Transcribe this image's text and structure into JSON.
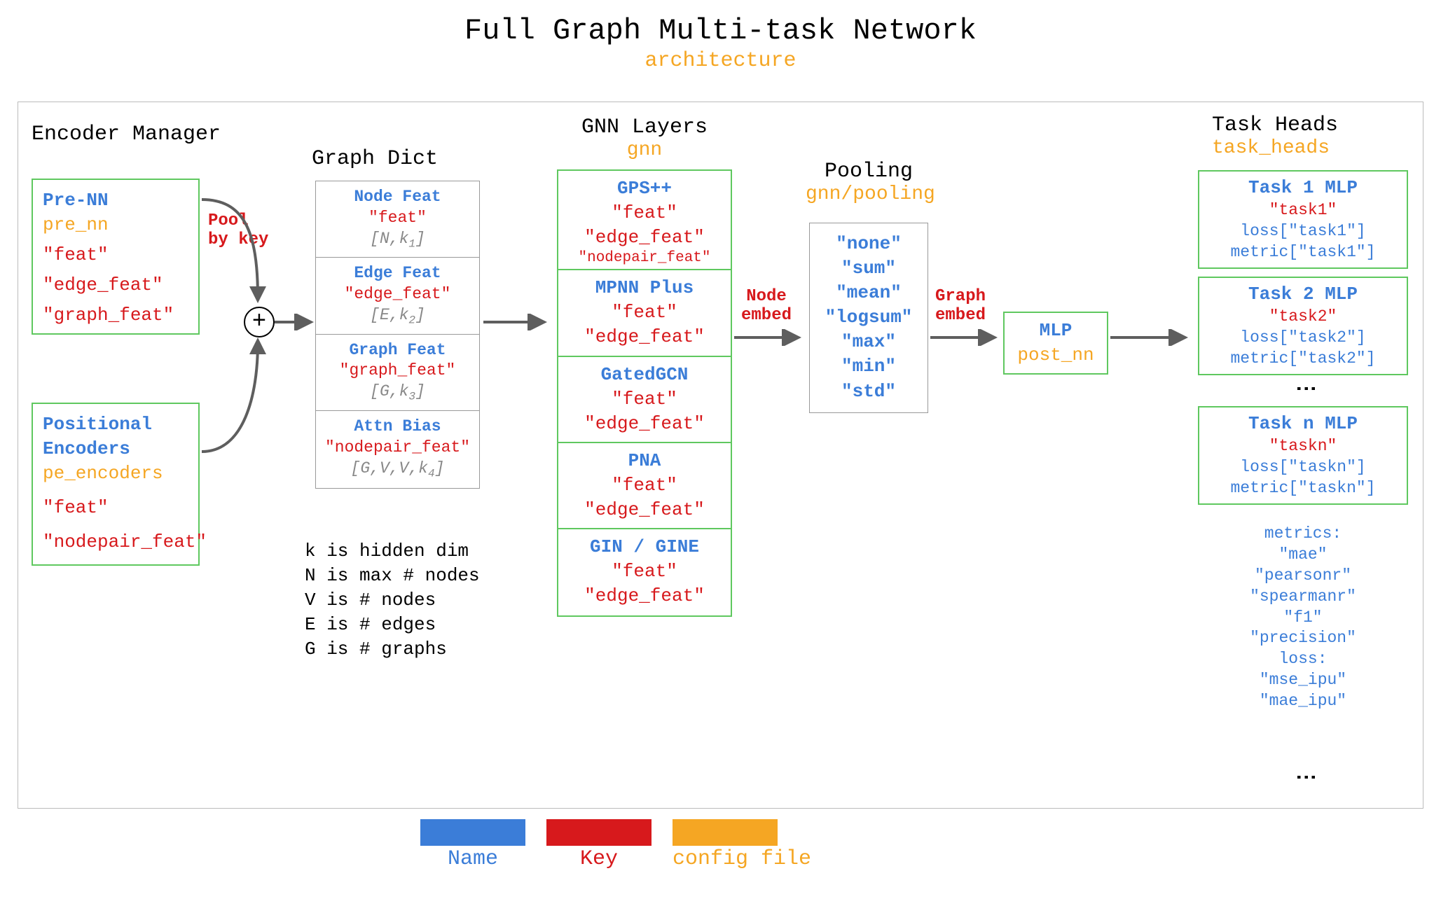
{
  "title": "Full Graph Multi-task Network",
  "subtitle": "architecture",
  "encoder_manager": {
    "title": "Encoder Manager",
    "pre_nn": {
      "name": "Pre-NN",
      "config": "pre_nn",
      "keys": [
        "\"feat\"",
        "\"edge_feat\"",
        "\"graph_feat\""
      ]
    },
    "positional": {
      "name1": "Positional",
      "name2": "Encoders",
      "config": "pe_encoders",
      "keys": [
        "\"feat\"",
        "\"nodepair_feat\""
      ]
    }
  },
  "pool_label": {
    "l1": "Pool",
    "l2": "by key"
  },
  "plus_symbol": "+",
  "graph_dict": {
    "title": "Graph Dict",
    "rows": [
      {
        "name": "Node Feat",
        "key": "\"feat\"",
        "shape_a": "N",
        "shape_b": "k",
        "sub": "1"
      },
      {
        "name": "Edge Feat",
        "key": "\"edge_feat\"",
        "shape_a": "E",
        "shape_b": "k",
        "sub": "2"
      },
      {
        "name": "Graph Feat",
        "key": "\"graph_feat\"",
        "shape_a": "G",
        "shape_b": "k",
        "sub": "3"
      },
      {
        "name": "Attn Bias",
        "key": "\"nodepair_feat\"",
        "shape_pre": "G,V,V,",
        "shape_b": "k",
        "sub": "4"
      }
    ],
    "legend": [
      "k is hidden dim",
      "N is max # nodes",
      "V is # nodes",
      "E is # edges",
      "G is # graphs"
    ]
  },
  "gnn": {
    "title": "GNN Layers",
    "config": "gnn",
    "layers": [
      {
        "name": "GPS++",
        "keys": [
          "\"feat\"",
          "\"edge_feat\""
        ],
        "extra": "\"nodepair_feat\""
      },
      {
        "name": "MPNN Plus",
        "keys": [
          "\"feat\"",
          "\"edge_feat\""
        ]
      },
      {
        "name": "GatedGCN",
        "keys": [
          "\"feat\"",
          "\"edge_feat\""
        ]
      },
      {
        "name": "PNA",
        "keys": [
          "\"feat\"",
          "\"edge_feat\""
        ]
      },
      {
        "name": "GIN / GINE",
        "keys": [
          "\"feat\"",
          "\"edge_feat\""
        ]
      }
    ]
  },
  "arrow_labels": {
    "node_embed_1": "Node",
    "node_embed_2": "embed",
    "graph_embed_1": "Graph",
    "graph_embed_2": "embed"
  },
  "pooling": {
    "title": "Pooling",
    "config": "gnn/pooling",
    "options": [
      "\"none\"",
      "\"sum\"",
      "\"mean\"",
      "\"logsum\"",
      "\"max\"",
      "\"min\"",
      "\"std\""
    ]
  },
  "mlp": {
    "name": "MLP",
    "config": "post_nn"
  },
  "task_heads": {
    "title": "Task Heads",
    "config": "task_heads",
    "tasks": [
      {
        "name": "Task 1 MLP",
        "key": "\"task1\"",
        "loss": "loss[\"task1\"]",
        "metric": "metric[\"task1\"]"
      },
      {
        "name": "Task 2 MLP",
        "key": "\"task2\"",
        "loss": "loss[\"task2\"]",
        "metric": "metric[\"task2\"]"
      },
      {
        "name": "Task n MLP",
        "key": "\"taskn\"",
        "loss": "loss[\"taskn\"]",
        "metric": "metric[\"taskn\"]"
      }
    ],
    "metrics_label": "metrics:",
    "metrics": [
      "\"mae\"",
      "\"pearsonr\"",
      "\"spearmanr\"",
      "\"f1\"",
      "\"precision\""
    ],
    "loss_label": "loss:",
    "losses": [
      "\"mse_ipu\"",
      "\"mae_ipu\""
    ]
  },
  "legend": {
    "name": "Name",
    "key": "Key",
    "config": "config file",
    "colors": {
      "name": "#3b7dd8",
      "key": "#d7191c",
      "config": "#f5a623"
    }
  }
}
